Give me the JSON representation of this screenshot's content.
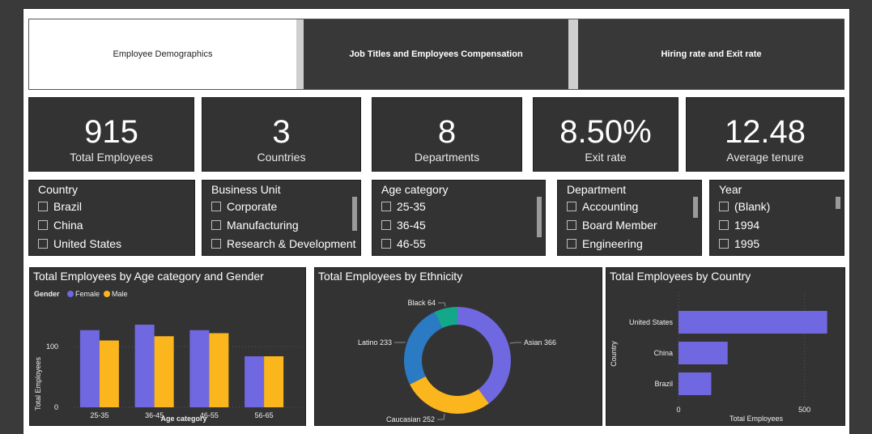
{
  "tabs": [
    {
      "label": "Employee Demographics",
      "active": true
    },
    {
      "label": "Job Titles and Employees Compensation",
      "active": false
    },
    {
      "label": "Hiring rate and Exit rate",
      "active": false
    }
  ],
  "kpis": [
    {
      "value": "915",
      "label": "Total Employees"
    },
    {
      "value": "3",
      "label": "Countries"
    },
    {
      "value": "8",
      "label": "Departments"
    },
    {
      "value": "8.50%",
      "label": "Exit rate"
    },
    {
      "value": "12.48",
      "label": "Average tenure"
    }
  ],
  "slicers": [
    {
      "title": "Country",
      "items": [
        "Brazil",
        "China",
        "United States"
      ],
      "scrollbar": false
    },
    {
      "title": "Business Unit",
      "items": [
        "Corporate",
        "Manufacturing",
        "Research & Development"
      ],
      "scrollbar": true
    },
    {
      "title": "Age category",
      "items": [
        "25-35",
        "36-45",
        "46-55"
      ],
      "scrollbar": true
    },
    {
      "title": "Department",
      "items": [
        "Accounting",
        "Board Member",
        "Engineering"
      ],
      "scrollbar": true
    },
    {
      "title": "Year",
      "items": [
        "(Blank)",
        "1994",
        "1995"
      ],
      "scrollbar": true
    }
  ],
  "colors": {
    "female": "#7068e0",
    "male": "#fcb61d",
    "asian": "#7068e0",
    "caucasian": "#fcb61d",
    "latino": "#2b7ac4",
    "black": "#14a88b",
    "bar": "#7068e0"
  },
  "chart_data": [
    {
      "type": "bar",
      "title": "Total Employees by Age category and Gender",
      "legend_title": "Gender",
      "xlabel": "Age category",
      "ylabel": "Total Employees",
      "categories": [
        "25-35",
        "36-45",
        "46-55",
        "56-65"
      ],
      "series": [
        {
          "name": "Female",
          "values": [
            127,
            136,
            127,
            84
          ]
        },
        {
          "name": "Male",
          "values": [
            110,
            117,
            122,
            84
          ]
        }
      ],
      "yticks": [
        "0",
        "100"
      ],
      "ylim": [
        0,
        160
      ],
      "legend_position": "top-left"
    },
    {
      "type": "pie",
      "title": "Total Employees by Ethnicity",
      "slices": [
        {
          "name": "Asian",
          "value": 366,
          "label": "Asian 366"
        },
        {
          "name": "Caucasian",
          "value": 252,
          "label": "Caucasian 252"
        },
        {
          "name": "Latino",
          "value": 233,
          "label": "Latino 233"
        },
        {
          "name": "Black",
          "value": 64,
          "label": "Black 64"
        }
      ]
    },
    {
      "type": "bar",
      "orientation": "horizontal",
      "title": "Total Employees by Country",
      "xlabel": "Total Employees",
      "ylabel": "Country",
      "categories": [
        "United States",
        "China",
        "Brazil"
      ],
      "values": [
        590,
        195,
        130
      ],
      "xticks": [
        "0",
        "500"
      ],
      "xlim": [
        0,
        620
      ]
    }
  ]
}
